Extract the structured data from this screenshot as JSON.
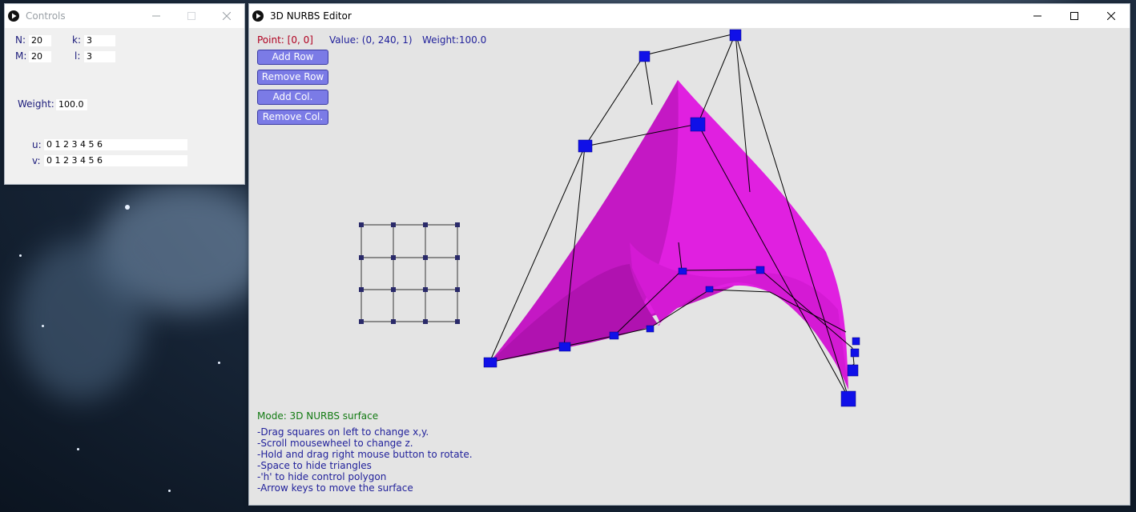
{
  "controls": {
    "title": "Controls",
    "n_label": "N:",
    "n_value": "20",
    "m_label": "M:",
    "m_value": "20",
    "k_label": "k:",
    "k_value": "3",
    "l_label": "l:",
    "l_value": "3",
    "weight_label": "Weight:",
    "weight_value": "100.0",
    "u_label": "u:",
    "u_value": "0 1 2 3 4 5 6",
    "v_label": "v:",
    "v_value": "0 1 2 3 4 5 6"
  },
  "editor": {
    "title": "3D NURBS Editor",
    "point_text": "Point: [0, 0]",
    "value_text": "Value: (0, 240, 1)",
    "weight_text": "Weight:100.0",
    "buttons": {
      "add_row": "Add Row",
      "remove_row": "Remove Row",
      "add_col": "Add Col.",
      "remove_col": "Remove Col."
    },
    "mode_text": "Mode: 3D NURBS surface",
    "help": [
      "-Drag squares on left to change x,y.",
      "-Scroll mousewheel to change z.",
      "-Hold and drag right mouse button to rotate.",
      "-Space to hide triangles",
      "-'h' to hide control polygon",
      "-Arrow keys to move the surface"
    ]
  },
  "colors": {
    "surface": "#e020e0",
    "control_point": "#1010e8",
    "canvas_bg": "#e4e4e4",
    "button_bg": "#7b7be6",
    "point_text": "#b00020",
    "info_text": "#1f1f9a",
    "mode_text": "#127a12"
  },
  "icons": {
    "app": "play-circle-icon",
    "minimize": "minimize-icon",
    "maximize": "maximize-icon",
    "close": "close-icon"
  }
}
